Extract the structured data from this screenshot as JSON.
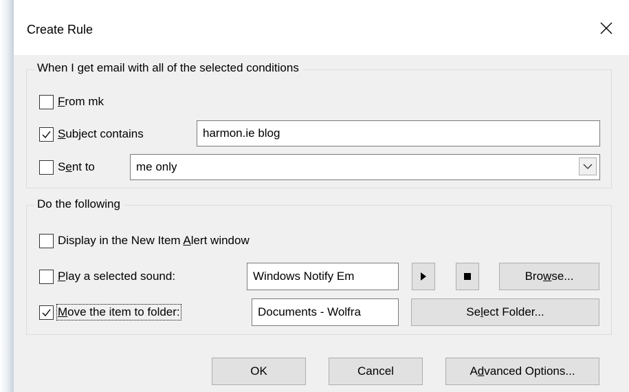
{
  "window": {
    "title": "Create Rule",
    "close_label": "×"
  },
  "conditions": {
    "legend": "When I get email with all of the selected conditions",
    "from": {
      "checked": false,
      "accel": "F",
      "rest": "rom mk"
    },
    "subject": {
      "checked": true,
      "accel": "S",
      "rest": "ubject contains",
      "value": "harmon.ie blog"
    },
    "sent_to": {
      "checked": false,
      "pre": "S",
      "accel": "e",
      "rest": "nt to",
      "value": "me only"
    }
  },
  "actions": {
    "legend": "Do the following",
    "alert": {
      "checked": false,
      "pre": "Display in the New Item ",
      "accel": "A",
      "rest": "lert window"
    },
    "sound": {
      "checked": false,
      "accel": "P",
      "rest": "lay a selected sound:",
      "value": "Windows Notify Em"
    },
    "move": {
      "checked": true,
      "accel": "M",
      "rest": "ove the item to folder:",
      "value": "Documents - Wolfra"
    },
    "browse": {
      "pre": "Bro",
      "accel": "w",
      "rest": "se..."
    },
    "select_folder": {
      "pre": "Se",
      "accel": "l",
      "rest": "ect Folder..."
    }
  },
  "buttons": {
    "ok": "OK",
    "cancel": "Cancel",
    "advanced": {
      "pre": "A",
      "accel": "d",
      "rest": "vanced Options..."
    }
  },
  "icons": {
    "close": "close-icon",
    "checkmark": "checkmark-icon",
    "chevron": "chevron-down-icon",
    "play": "play-icon",
    "stop": "stop-icon"
  }
}
